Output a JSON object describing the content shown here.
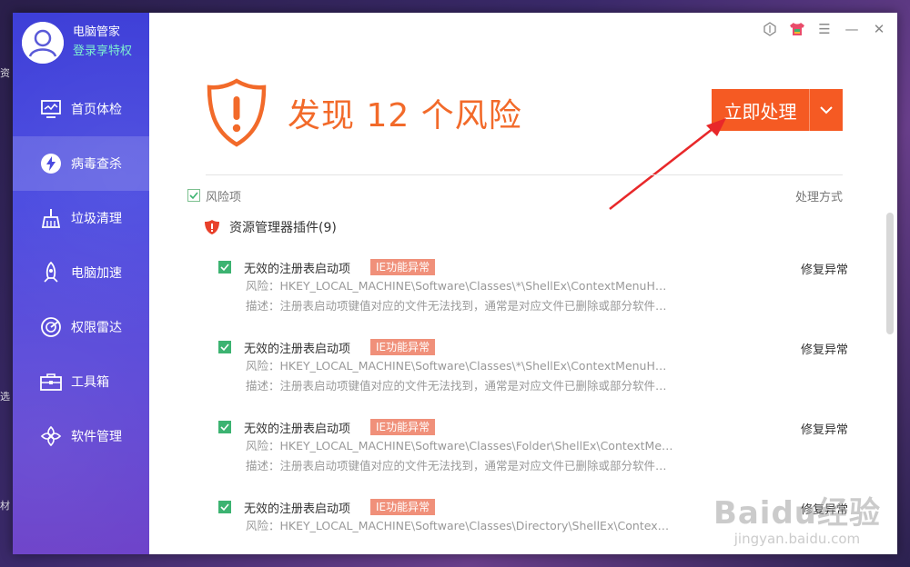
{
  "desktop": {
    "glyphs": [
      "资",
      "选",
      "材"
    ]
  },
  "sidebar": {
    "app_name": "电脑管家",
    "login_link": "登录享特权",
    "items": [
      {
        "label": "首页体检",
        "icon": "monitor-icon",
        "active": false
      },
      {
        "label": "病毒查杀",
        "icon": "lightning-icon",
        "active": true
      },
      {
        "label": "垃圾清理",
        "icon": "broom-icon",
        "active": false
      },
      {
        "label": "电脑加速",
        "icon": "rocket-icon",
        "active": false
      },
      {
        "label": "权限雷达",
        "icon": "radar-icon",
        "active": false
      },
      {
        "label": "工具箱",
        "icon": "toolbox-icon",
        "active": false
      },
      {
        "label": "软件管理",
        "icon": "software-icon",
        "active": false
      }
    ]
  },
  "header": {
    "headline": "发现 12 个风险",
    "action_label": "立即处理"
  },
  "list": {
    "header_label": "风险项",
    "handle_label": "处理方式",
    "group_label": "资源管理器插件(9)",
    "items": [
      {
        "title": "无效的注册表启动项",
        "badge": "IE功能异常",
        "fix": "修复异常",
        "risk": "风险：HKEY_LOCAL_MACHINE\\Software\\Classes\\*\\ShellEx\\ContextMenuHand...",
        "desc": "描述：注册表启动项键值对应的文件无法找到，通常是对应文件已删除或部分软件卸..."
      },
      {
        "title": "无效的注册表启动项",
        "badge": "IE功能异常",
        "fix": "修复异常",
        "risk": "风险：HKEY_LOCAL_MACHINE\\Software\\Classes\\*\\ShellEx\\ContextMenuHand...",
        "desc": "描述：注册表启动项键值对应的文件无法找到，通常是对应文件已删除或部分软件卸..."
      },
      {
        "title": "无效的注册表启动项",
        "badge": "IE功能异常",
        "fix": "修复异常",
        "risk": "风险：HKEY_LOCAL_MACHINE\\Software\\Classes\\Folder\\ShellEx\\ContextMenu...",
        "desc": "描述：注册表启动项键值对应的文件无法找到，通常是对应文件已删除或部分软件卸..."
      },
      {
        "title": "无效的注册表启动项",
        "badge": "IE功能异常",
        "fix": "修复异常",
        "risk": "风险：HKEY_LOCAL_MACHINE\\Software\\Classes\\Directory\\ShellEx\\ContextMe...",
        "desc": ""
      }
    ]
  },
  "watermark": {
    "main": "Baidu经验",
    "sub": "jingyan.baidu.com"
  },
  "colors": {
    "accent": "#f26a2a",
    "button": "#f55a23",
    "check": "#3cb371",
    "badge": "#f0907a",
    "sidebar": "#4a4ae0"
  }
}
